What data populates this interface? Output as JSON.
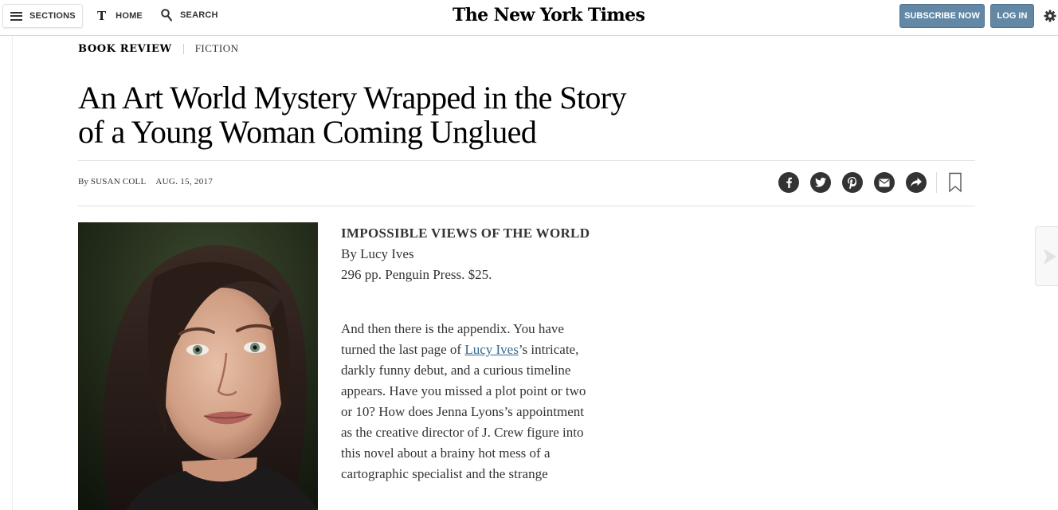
{
  "masthead": {
    "sections_label": "SECTIONS",
    "home_label": "HOME",
    "home_icon": "T",
    "search_label": "SEARCH",
    "logo_text": "The New York Times",
    "subscribe_label": "SUBSCRIBE NOW",
    "login_label": "LOG IN",
    "accent_color": "#6288a5"
  },
  "article": {
    "section": "BOOK REVIEW",
    "subsection": "FICTION",
    "headline": "An Art World Mystery Wrapped in the Story of a Young Woman Coming Unglued",
    "byline_prefix": "By",
    "author": "SUSAN COLL",
    "date": "AUG. 15, 2017",
    "share_icons": [
      "facebook-icon",
      "twitter-icon",
      "pinterest-icon",
      "email-icon",
      "share-icon"
    ],
    "bookmark_icon": "bookmark-icon"
  },
  "book": {
    "title": "IMPOSSIBLE VIEWS OF THE WORLD",
    "author_line": "By Lucy Ives",
    "details": "296 pp. Penguin Press. $25."
  },
  "body": {
    "p1_before": "And then there is the appendix. You have turned the last page of ",
    "p1_link": "Lucy Ives",
    "p1_after": "’s intricate, darkly funny debut, and a curious timeline appears. Have you missed a plot point or two or 10? How does Jenna Lyons’s appointment as the creative director of J. Crew figure into this novel about a brainy hot mess of a cartographic specialist and the strange",
    "link_color": "#326891"
  }
}
